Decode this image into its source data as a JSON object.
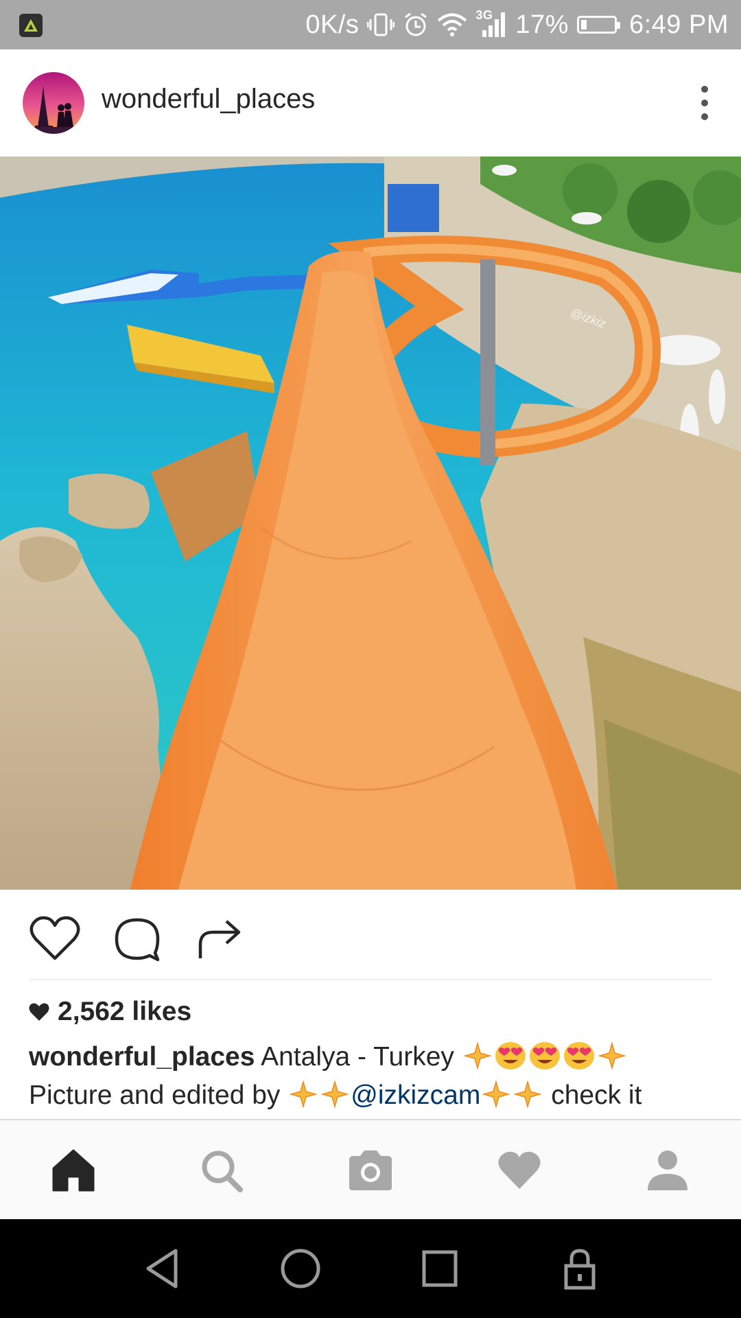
{
  "status_bar": {
    "network_speed": "0K/s",
    "network_type": "3G",
    "battery": "17%",
    "battery_level": 0.17,
    "time": "6:49 PM"
  },
  "post": {
    "username": "wonderful_places",
    "likes": "2,562 likes",
    "caption": {
      "username": "wonderful_places",
      "location_text": " Antalya - Turkey ",
      "line2_prefix": "Picture and edited by ",
      "mention": "@izkizcam",
      "line2_suffix": " check it"
    },
    "photo_watermark": "@izkiz"
  },
  "icons": {
    "header_more": "more-vertical-icon",
    "like": "heart-outline-icon",
    "comment": "comment-icon",
    "share": "share-arrow-icon",
    "likes_heart": "heart-filled-icon",
    "nav": [
      "home-icon",
      "search-icon",
      "camera-icon",
      "heart-icon",
      "profile-icon"
    ],
    "system": [
      "back-icon",
      "home-circle-icon",
      "recents-icon",
      "lock-icon"
    ]
  },
  "colors": {
    "status_bar": "#a8a8a8",
    "text": "#262626",
    "mention": "#003569",
    "nav_active": "#262626",
    "nav_inactive": "#a8a8a8",
    "slide_orange": "#f39a4a",
    "sea": "#1fb7d4"
  }
}
